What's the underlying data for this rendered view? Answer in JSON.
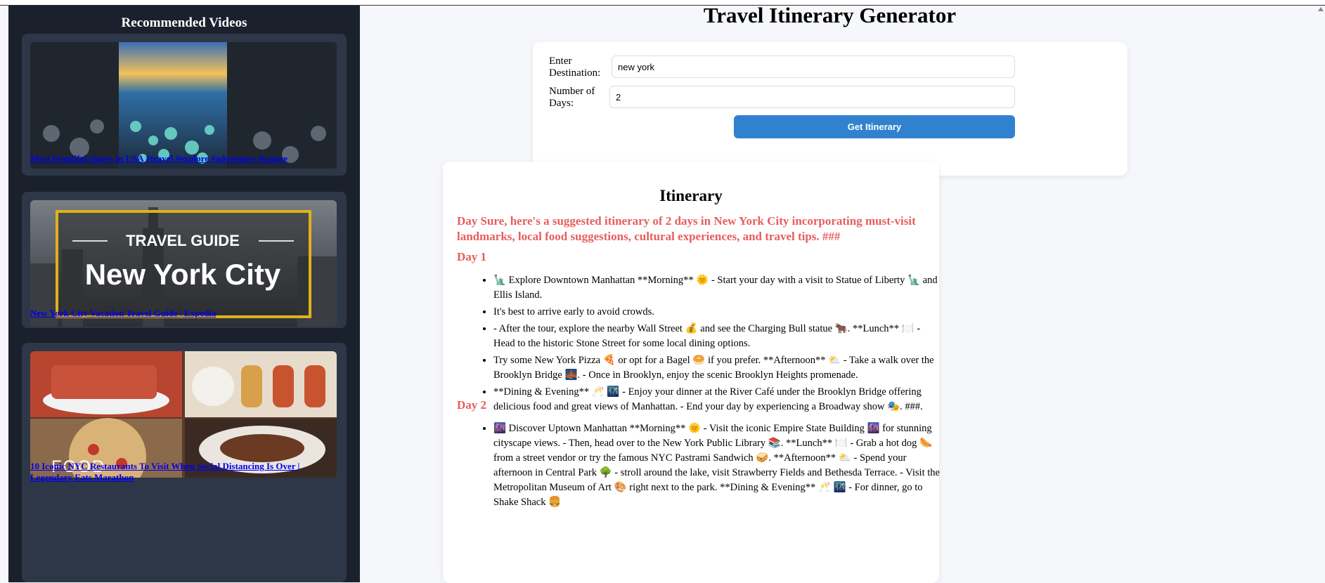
{
  "sidebar": {
    "title": "Recommended Videos",
    "videos": [
      {
        "title": "Most beautiful places in USA #travel #explore #adventure #nature"
      },
      {
        "title": "New York City Vacation Travel Guide | Expedia",
        "thumb_line1": "TRAVEL GUIDE",
        "thumb_line2": "New York City"
      },
      {
        "title": "10 Iconic NYC Restaurants To Visit When Social Distancing Is Over | Legendary Eats Marathon",
        "thumb_text": "FOOD"
      }
    ]
  },
  "main": {
    "title": "Travel Itinerary Generator",
    "form": {
      "destination_label": "Enter Destination:",
      "destination_value": "new york",
      "days_label": "Number of Days:",
      "days_value": "2",
      "submit_label": "Get Itinerary"
    },
    "itinerary": {
      "title": "Itinerary",
      "intro": "Day Sure, here's a suggested itinerary of 2 days in New York City incorporating must-visit landmarks, local food suggestions, cultural experiences, and travel tips. ###",
      "days": [
        {
          "heading": "Day 1",
          "items": [
            "🗽 Explore Downtown Manhattan **Morning** 🌞 - Start your day with a visit to Statue of Liberty 🗽 and Ellis Island.",
            "It's best to arrive early to avoid crowds.",
            "- After the tour, explore the nearby Wall Street 💰 and see the Charging Bull statue 🐂. **Lunch** 🍽️ - Head to the historic Stone Street for some local dining options.",
            "Try some New York Pizza 🍕 or opt for a Bagel 🥯 if you prefer. **Afternoon** ⛅ - Take a walk over the Brooklyn Bridge 🌉. - Once in Brooklyn, enjoy the scenic Brooklyn Heights promenade.",
            "**Dining & Evening** 🥂 🌃 - Enjoy your dinner at the River Café under the Brooklyn Bridge offering delicious food and great views of Manhattan. - End your day by experiencing a Broadway show 🎭. ###."
          ]
        },
        {
          "heading": "Day 2",
          "items": [
            "🌆 Discover Uptown Manhattan **Morning** 🌞 - Visit the iconic Empire State Building 🌆 for stunning cityscape views. - Then, head over to the New York Public Library 📚. **Lunch** 🍽️ - Grab a hot dog 🌭 from a street vendor or try the famous NYC Pastrami Sandwich 🥪. **Afternoon** ⛅ - Spend your afternoon in Central Park 🌳 - stroll around the lake, visit Strawberry Fields and Bethesda Terrace. - Visit the Metropolitan Museum of Art 🎨 right next to the park. **Dining & Evening** 🥂 🌃 - For dinner, go to Shake Shack 🍔"
          ]
        }
      ]
    }
  },
  "colors": {
    "sidebar_bg": "#1a202c",
    "card_bg": "#2d3748",
    "accent": "#3182ce",
    "heading_red": "#e85d5d"
  }
}
